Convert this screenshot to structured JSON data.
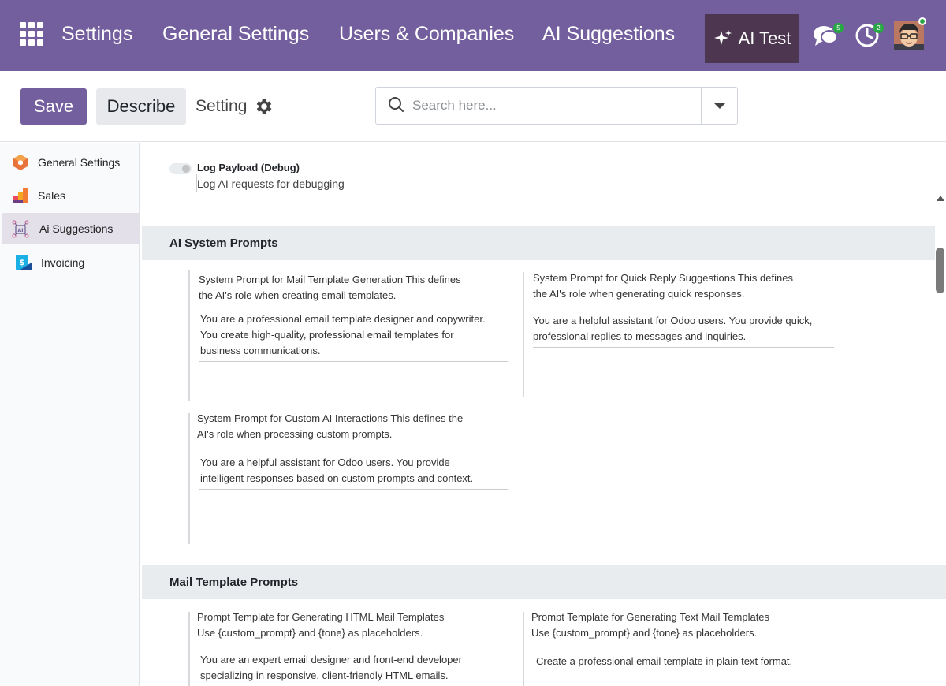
{
  "navbar": {
    "items": [
      {
        "label": "Settings"
      },
      {
        "label": "General Settings"
      },
      {
        "label": "Users & Companies"
      },
      {
        "label": "AI Suggestions"
      }
    ],
    "ai_button": "AI Test",
    "messages_count": "5",
    "activities_count": "2",
    "bg_color": "#735f9e"
  },
  "control": {
    "save_label": "Save",
    "describe_label": "Describe",
    "setting_label": "Setting",
    "search_placeholder": "Search here..."
  },
  "sidebar": {
    "items": [
      {
        "label": "General Settings",
        "icon": "hexagon-icon"
      },
      {
        "label": "Sales",
        "icon": "sales-icon"
      },
      {
        "label": "Ai Suggestions",
        "icon": "ai-icon",
        "active": true
      },
      {
        "label": "Invoicing",
        "icon": "invoice-icon"
      }
    ]
  },
  "log_payload": {
    "title": "Log Payload (Debug)",
    "description": "Log AI requests for debugging",
    "enabled": false
  },
  "sections": [
    {
      "title": "AI System Prompts",
      "fields": [
        {
          "label_1": "System Prompt for Mail Template Generation This defines",
          "label_2": "the AI's role when creating email templates.",
          "value_1": "You are a professional email template designer and copywriter.",
          "value_2": "You create high-quality, professional email templates for",
          "value_3": "business communications."
        },
        {
          "label_1": "System Prompt for Quick Reply Suggestions This defines",
          "label_2": "the AI's role when generating quick responses.",
          "value_1": "You are a helpful assistant for Odoo users. You provide quick,",
          "value_2": "professional replies to messages and inquiries."
        },
        {
          "label_1": "System Prompt for Custom AI Interactions This defines the",
          "label_2": "AI's role when processing custom prompts.",
          "value_1": "You are a helpful assistant for Odoo users. You provide",
          "value_2": "intelligent responses based on custom prompts and context."
        }
      ]
    },
    {
      "title": "Mail Template Prompts",
      "fields": [
        {
          "label_1": "Prompt Template for Generating HTML Mail Templates",
          "label_2": "Use {custom_prompt} and {tone} as placeholders.",
          "value_1": "You are an expert email designer and front-end developer",
          "value_2": "specializing in responsive, client-friendly HTML emails."
        },
        {
          "label_1": "Prompt Template for Generating Text Mail Templates",
          "label_2": "Use {custom_prompt} and {tone} as placeholders.",
          "value_1": "Create a professional email template in plain text format."
        }
      ]
    }
  ]
}
